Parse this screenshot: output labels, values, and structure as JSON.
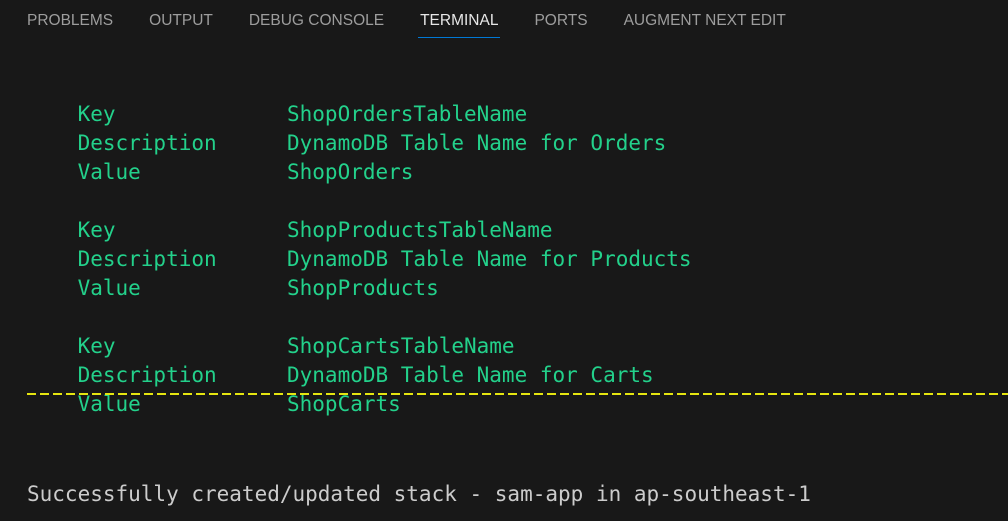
{
  "panel": {
    "tabs": [
      {
        "label": "PROBLEMS",
        "active": false
      },
      {
        "label": "OUTPUT",
        "active": false
      },
      {
        "label": "DEBUG CONSOLE",
        "active": false
      },
      {
        "label": "TERMINAL",
        "active": true
      },
      {
        "label": "PORTS",
        "active": false
      },
      {
        "label": "AUGMENT NEXT EDIT",
        "active": false
      }
    ]
  },
  "terminal": {
    "outputs": [
      {
        "key_label": "Key",
        "key": "ShopOrdersTableName",
        "desc_label": "Description",
        "description": "DynamoDB Table Name for Orders",
        "value_label": "Value",
        "value": "ShopOrders"
      },
      {
        "key_label": "Key",
        "key": "ShopProductsTableName",
        "desc_label": "Description",
        "description": "DynamoDB Table Name for Products",
        "value_label": "Value",
        "value": "ShopProducts"
      },
      {
        "key_label": "Key",
        "key": "ShopCartsTableName",
        "desc_label": "Description",
        "description": "DynamoDB Table Name for Carts",
        "value_label": "Value",
        "value": "ShopCarts"
      }
    ],
    "success_message": "Successfully created/updated stack - sam-app in ap-southeast-1",
    "colors": {
      "output_text": "#23d18b",
      "separator": "#e5e510",
      "plain_text": "#cccccc",
      "active_tab_underline": "#0078d4"
    }
  }
}
